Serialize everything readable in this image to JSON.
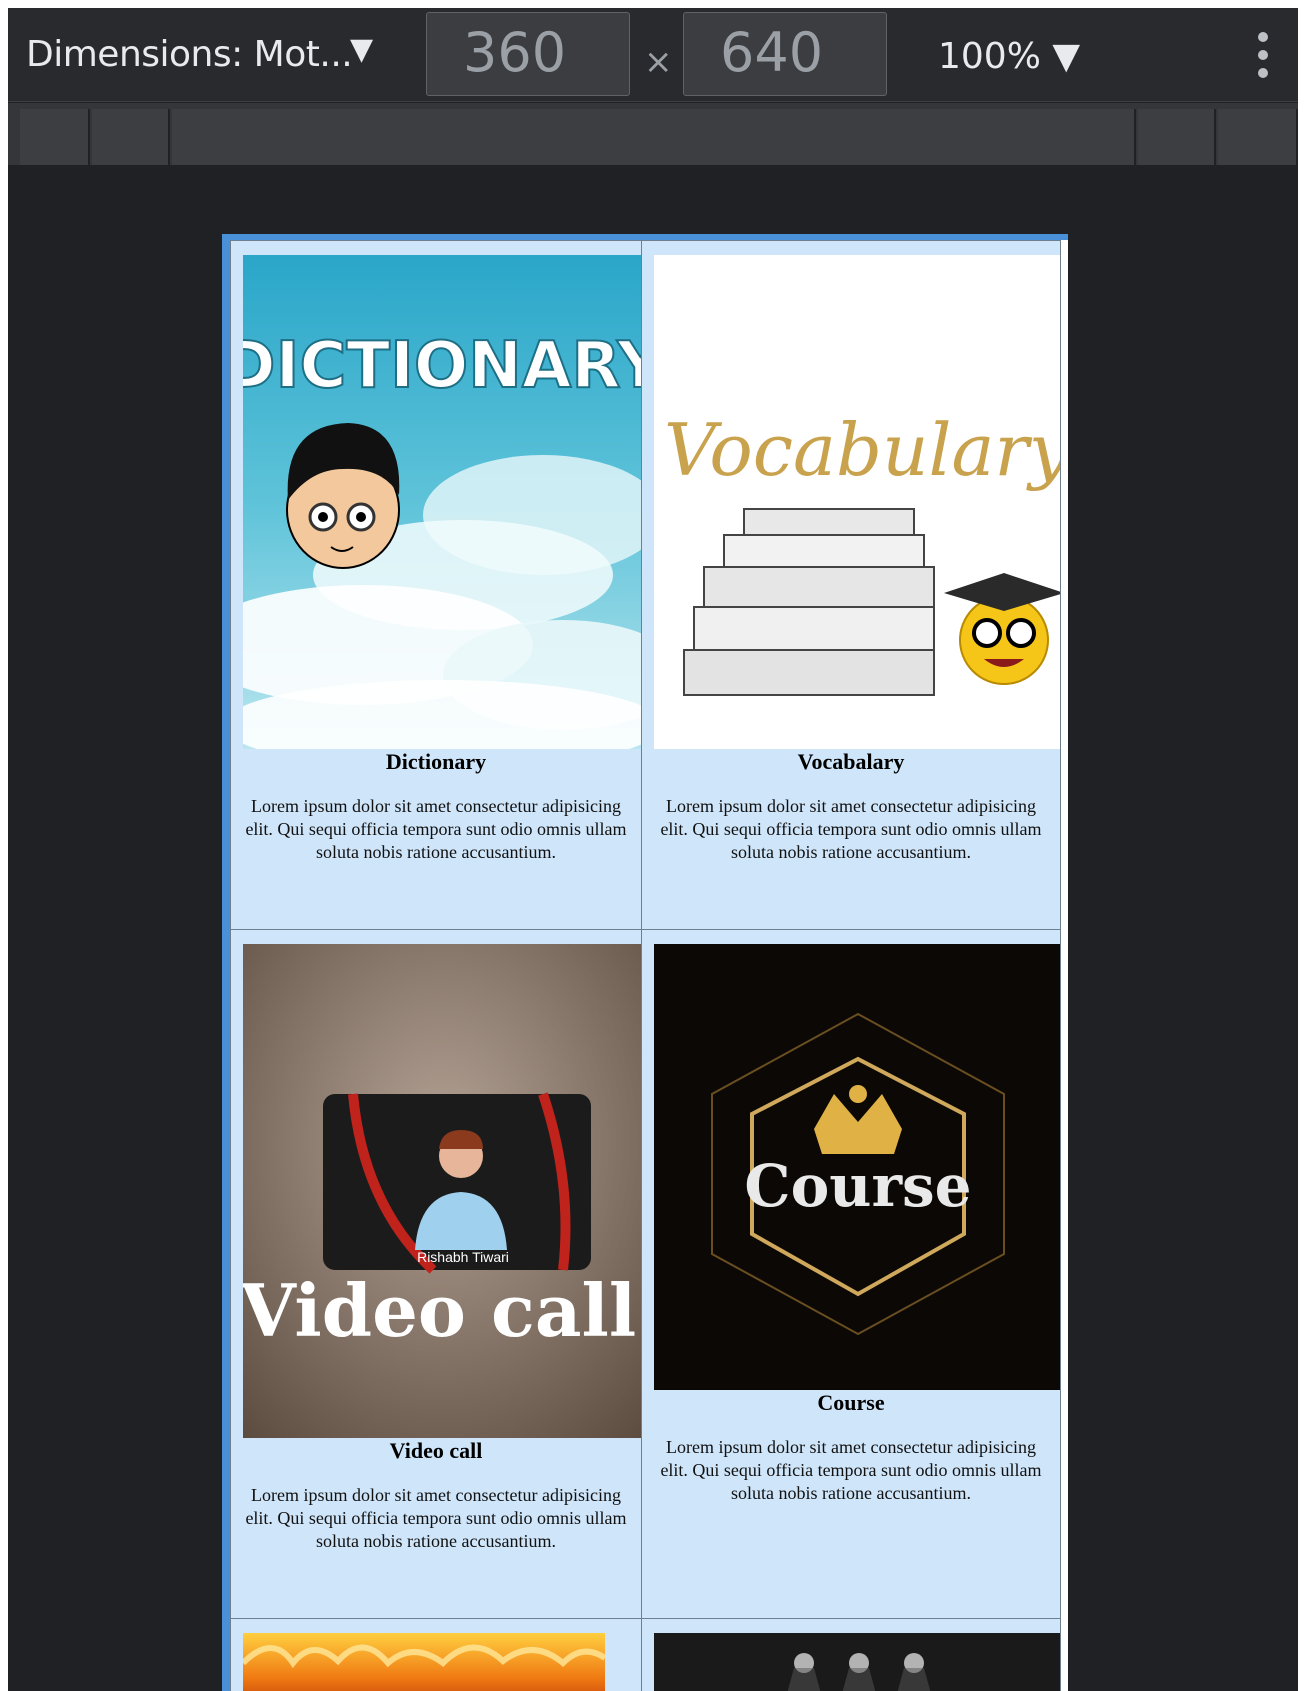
{
  "toolbar": {
    "dimensions_label": "Dimensions: Mot...",
    "dropdown_arrow": "▼",
    "width_value": "360",
    "times": "×",
    "height_value": "640",
    "zoom_label": "100% ▼"
  },
  "cards": [
    {
      "title": "Dictionary",
      "image_text": "DICTIONARY",
      "description": "Lorem ipsum dolor sit amet consectetur adipisicing elit. Qui sequi officia tempora sunt odio omnis ullam soluta nobis ratione accusantium."
    },
    {
      "title": "Vocabalary",
      "image_text": "Vocabulary",
      "description": "Lorem ipsum dolor sit amet consectetur adipisicing elit. Qui sequi officia tempora sunt odio omnis ullam soluta nobis ratione accusantium."
    },
    {
      "title": "Video call",
      "image_text": "Video call",
      "image_caption": "Rishabh Tiwari",
      "description": "Lorem ipsum dolor sit amet consectetur adipisicing elit. Qui sequi officia tempora sunt odio omnis ullam soluta nobis ratione accusantium."
    },
    {
      "title": "Course",
      "image_text": "Course",
      "description": "Lorem ipsum dolor sit amet consectetur adipisicing elit. Qui sequi officia tempora sunt odio omnis ullam soluta nobis ratione accusantium."
    }
  ],
  "colors": {
    "devtools_bg": "#202124",
    "card_bg": "#cfe5f9",
    "viewport_border": "#4a90d9"
  }
}
